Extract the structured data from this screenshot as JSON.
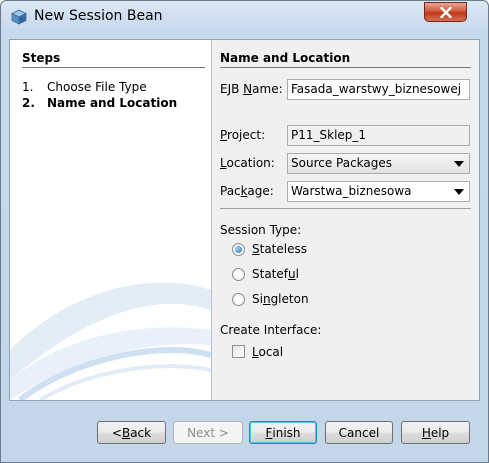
{
  "window": {
    "title": "New Session Bean",
    "app_icon": "cube-icon"
  },
  "steps": {
    "heading": "Steps",
    "items": [
      {
        "num": "1.",
        "label": "Choose File Type",
        "active": false
      },
      {
        "num": "2.",
        "label": "Name and Location",
        "active": true
      }
    ]
  },
  "form": {
    "heading": "Name and Location",
    "ejb_name": {
      "label_pre": "EJB ",
      "label_mnemonic": "N",
      "label_post": "ame:",
      "value": "Fasada_warstwy_biznesowej"
    },
    "project": {
      "label_pre": "",
      "label_mnemonic": "P",
      "label_post": "roject:",
      "value": "P11_Sklep_1"
    },
    "location": {
      "label_pre": "",
      "label_mnemonic": "L",
      "label_post": "ocation:",
      "value": "Source Packages"
    },
    "package": {
      "label_pre": "Pac",
      "label_mnemonic": "k",
      "label_post": "age:",
      "value": "Warstwa_biznesowa"
    },
    "session_type": {
      "label": "Session Type:",
      "options": [
        {
          "mnemonic": "S",
          "rest": "tateless",
          "selected": true
        },
        {
          "mnemonic": "",
          "rest": "Statef",
          "mnemonic2": "u",
          "rest2": "l",
          "selected": false
        },
        {
          "mnemonic": "",
          "rest": "Si",
          "mnemonic2": "n",
          "rest2": "gleton",
          "selected": false
        }
      ]
    },
    "create_interface": {
      "label": "Create Interface:",
      "local": {
        "mnemonic": "L",
        "rest": "ocal",
        "checked": false
      }
    }
  },
  "buttons": {
    "back": {
      "pre": "< ",
      "mnemonic": "B",
      "post": "ack"
    },
    "next": {
      "label": "Next >"
    },
    "finish": {
      "mnemonic": "F",
      "post": "inish"
    },
    "cancel": {
      "label": "Cancel"
    },
    "help": {
      "mnemonic": "H",
      "post": "elp"
    }
  },
  "colors": {
    "title_gradient_top": "#dbe8f5",
    "close_button": "#c0391e",
    "radio_selected": "#2c6fb5"
  }
}
